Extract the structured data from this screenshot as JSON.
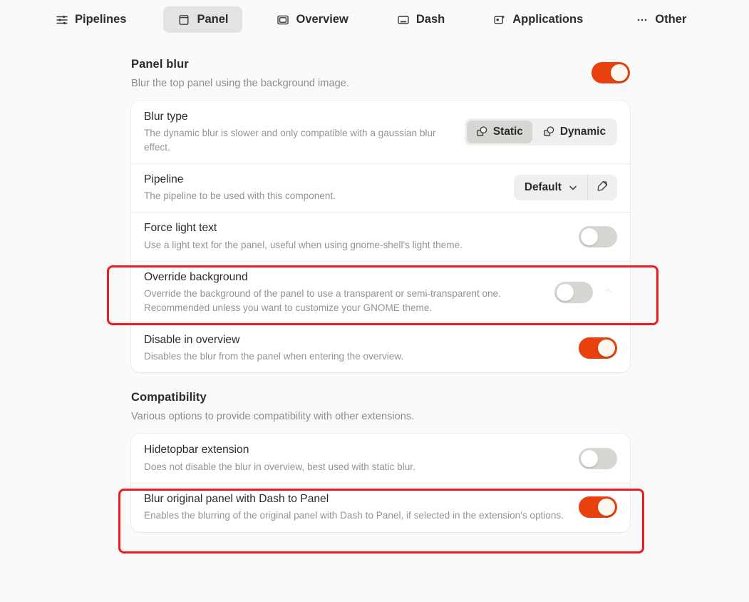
{
  "colors": {
    "accent": "#e8400e",
    "page_bg": "#fafafa",
    "card_bg": "#ffffff",
    "toggle_off": "#d6d6d3",
    "highlight": "#ec1c24",
    "segment_active": "#d6d6d3"
  },
  "tabs": [
    {
      "label": "Pipelines",
      "icon": "sliders-icon",
      "selected": false
    },
    {
      "label": "Panel",
      "icon": "panel-icon",
      "selected": true
    },
    {
      "label": "Overview",
      "icon": "overview-icon",
      "selected": false
    },
    {
      "label": "Dash",
      "icon": "dash-icon",
      "selected": false
    },
    {
      "label": "Applications",
      "icon": "applications-icon",
      "selected": false
    },
    {
      "label": "Other",
      "icon": "ellipsis-icon",
      "selected": false
    }
  ],
  "panel_blur": {
    "title": "Panel blur",
    "subtitle": "Blur the top panel using the background image.",
    "toggle": {
      "state": "on",
      "name": "panel-blur-toggle"
    }
  },
  "panel_rows": [
    {
      "name": "blur-type",
      "title": "Blur type",
      "subtitle": "The dynamic blur is slower and only compatible with a gaussian blur effect.",
      "control": "segmented",
      "options": [
        {
          "label": "Static",
          "icon": "shapes-icon",
          "active": true
        },
        {
          "label": "Dynamic",
          "icon": "shapes-icon",
          "active": false
        }
      ]
    },
    {
      "name": "pipeline",
      "title": "Pipeline",
      "subtitle": "The pipeline to be used with this component.",
      "control": "dropdown",
      "value": "Default",
      "edit_icon": "edit-icon",
      "chevron_icon": "chevron-down-icon"
    },
    {
      "name": "force-light-text",
      "title": "Force light text",
      "subtitle": "Use a light text for the panel, useful when using gnome-shell's light theme.",
      "control": "toggle",
      "state": "off"
    },
    {
      "name": "override-background",
      "title": "Override background",
      "subtitle": "Override the background of the panel to use a transparent or semi-transparent one. Recommended unless you want to customize your GNOME theme.",
      "control": "toggle",
      "state": "off",
      "expander_icon": "chevron-up-icon",
      "highlighted": true
    },
    {
      "name": "disable-in-overview",
      "title": "Disable in overview",
      "subtitle": "Disables the blur from the panel when entering the overview.",
      "control": "toggle",
      "state": "on"
    }
  ],
  "compatibility": {
    "title": "Compatibility",
    "subtitle": "Various options to provide compatibility with other extensions.",
    "rows": [
      {
        "name": "hidetopbar-extension",
        "title": "Hidetopbar extension",
        "subtitle": "Does not disable the blur in overview, best used with static blur.",
        "control": "toggle",
        "state": "off"
      },
      {
        "name": "blur-original-panel-dash-to-panel",
        "title": "Blur original panel with Dash to Panel",
        "subtitle": "Enables the blurring of the original panel with Dash to Panel, if selected in the extension's options.",
        "control": "toggle",
        "state": "on",
        "highlighted": true
      }
    ]
  }
}
